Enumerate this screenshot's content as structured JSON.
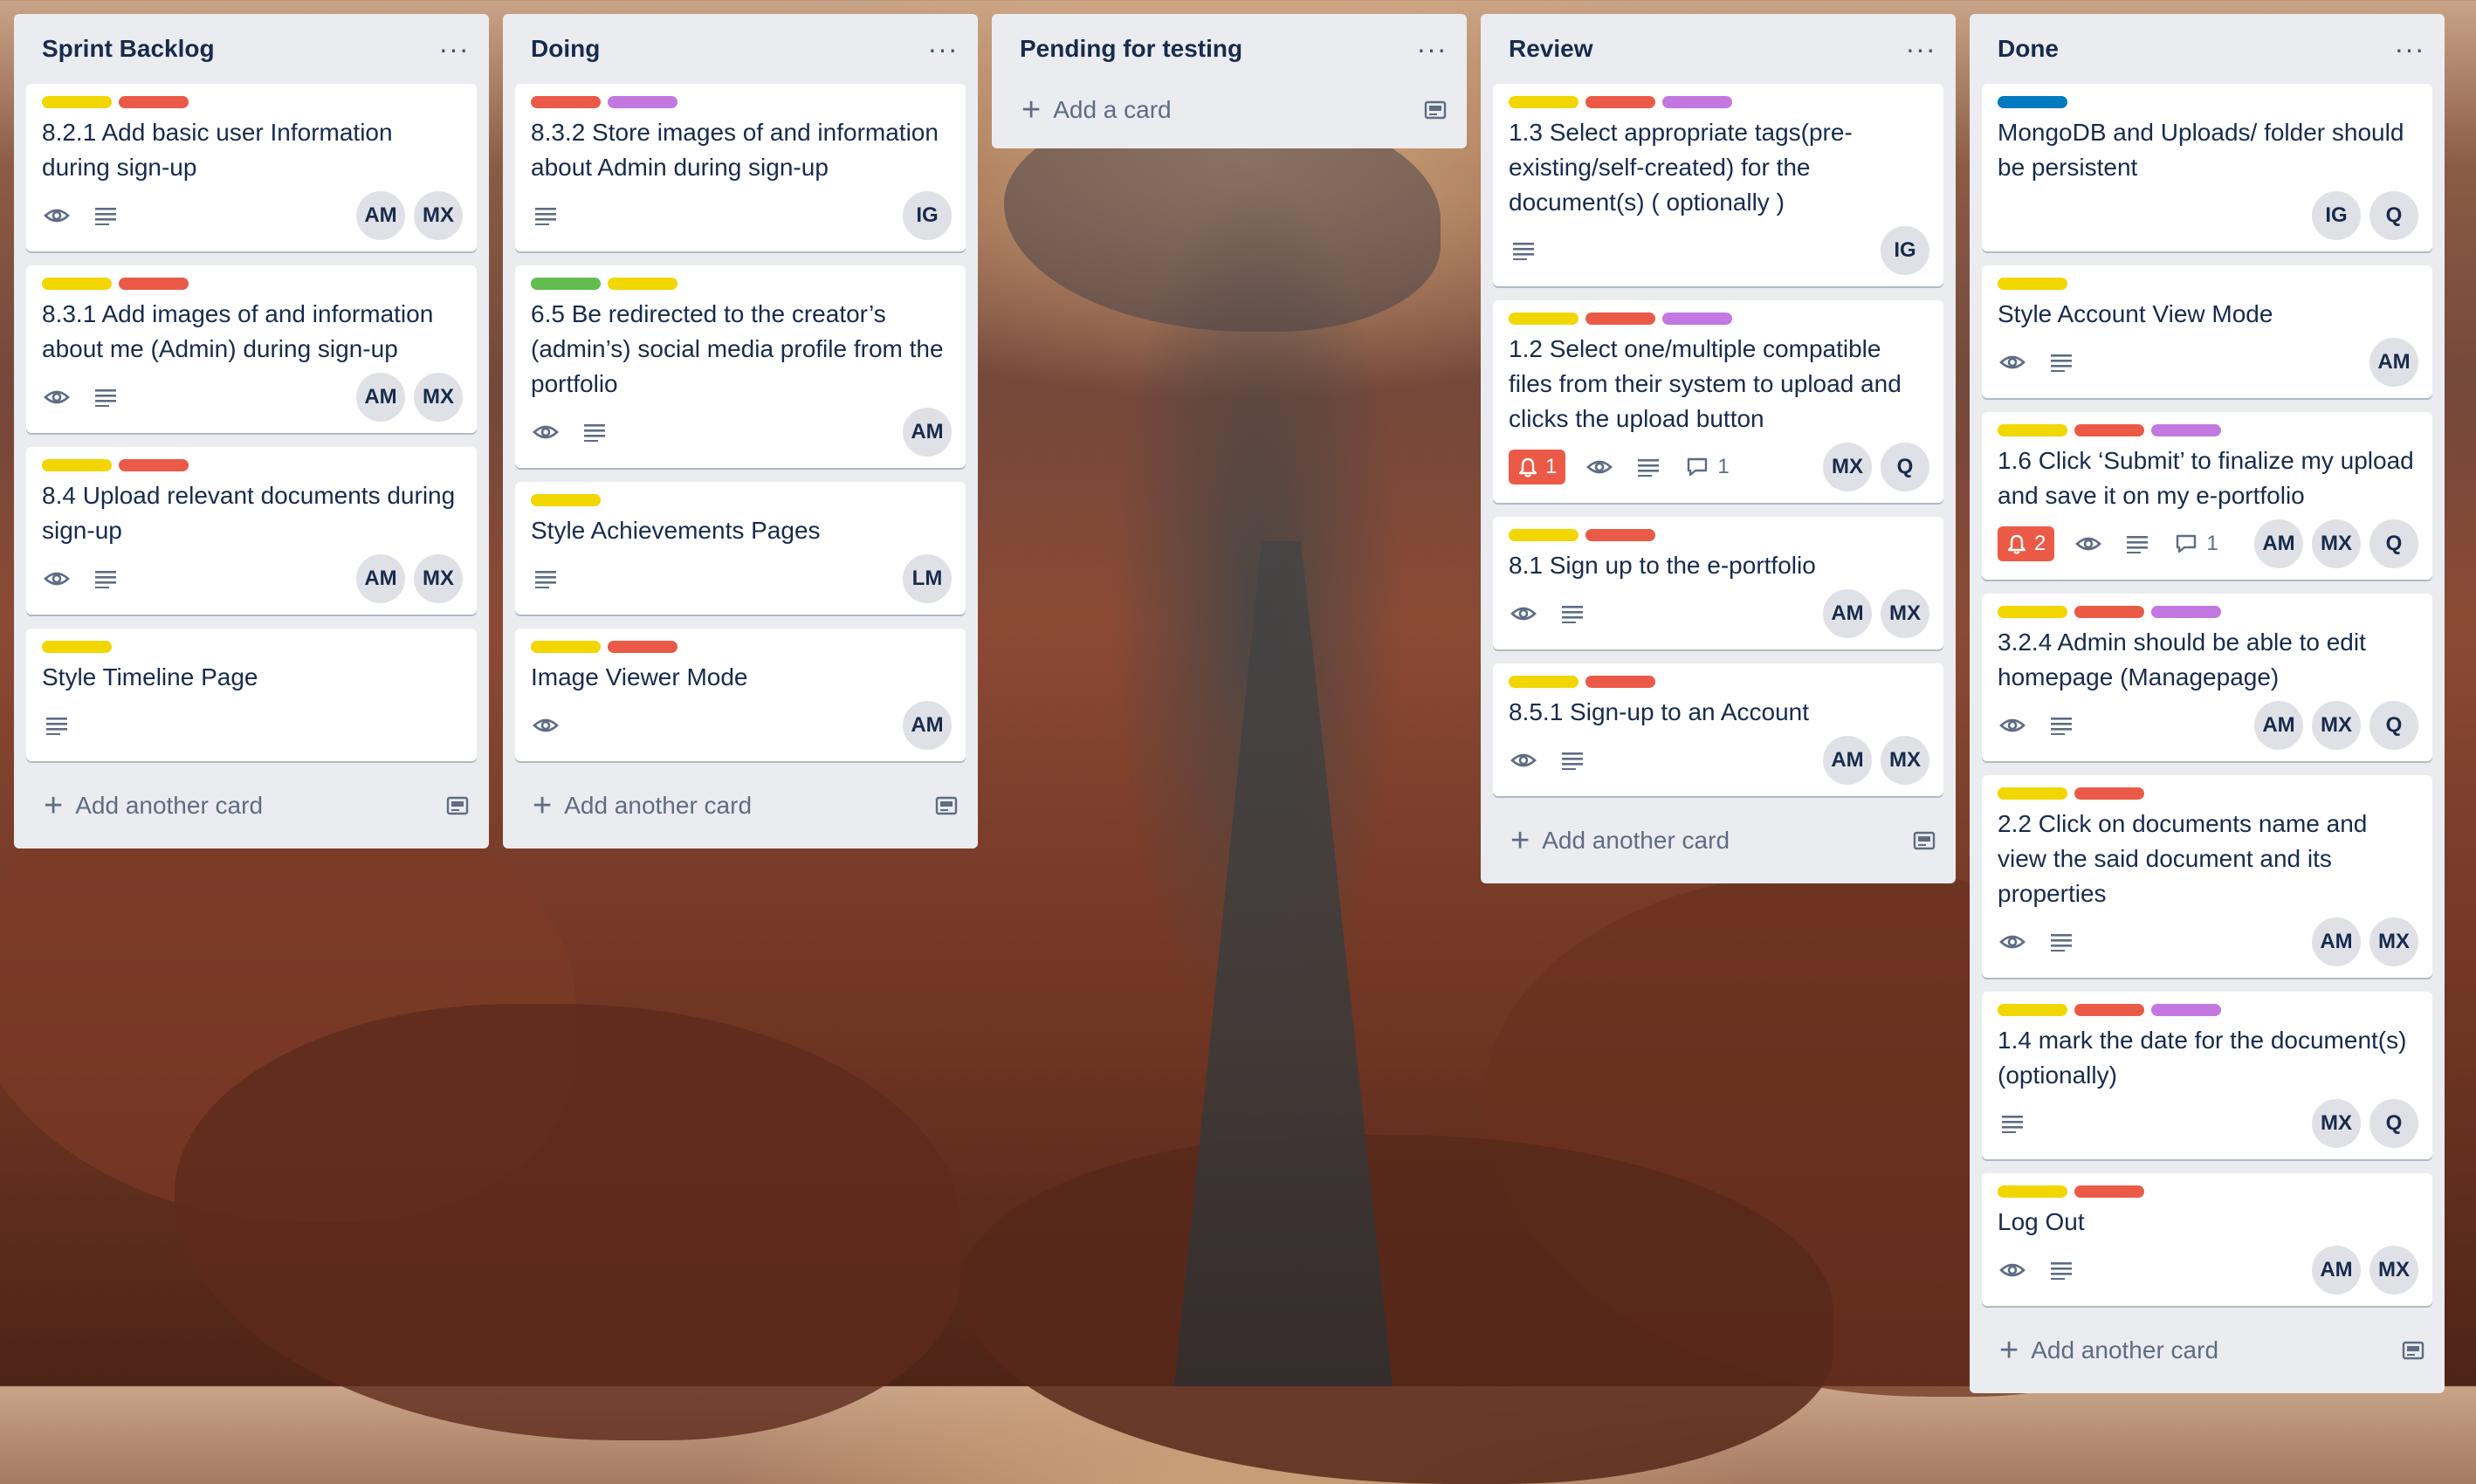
{
  "colors": {
    "yellow": "#f2d600",
    "red": "#eb5a46",
    "purple": "#c377e0",
    "green": "#61bd4f",
    "blue": "#0079bf"
  },
  "lists": [
    {
      "title": "Sprint Backlog",
      "add_label": "Add another card",
      "cards": [
        {
          "labels": [
            "yellow",
            "red"
          ],
          "title": "8.2.1 Add basic user Information during sign-up",
          "watch": true,
          "desc": true,
          "members": [
            "AM",
            "MX"
          ]
        },
        {
          "labels": [
            "yellow",
            "red"
          ],
          "title": "8.3.1 Add images of and information about me (Admin) during sign-up",
          "watch": true,
          "desc": true,
          "members": [
            "AM",
            "MX"
          ]
        },
        {
          "labels": [
            "yellow",
            "red"
          ],
          "title": "8.4 Upload relevant documents during sign-up",
          "watch": true,
          "desc": true,
          "members": [
            "AM",
            "MX"
          ]
        },
        {
          "labels": [
            "yellow"
          ],
          "title": "Style Timeline Page",
          "watch": false,
          "desc": true,
          "members": []
        }
      ]
    },
    {
      "title": "Doing",
      "add_label": "Add another card",
      "cards": [
        {
          "labels": [
            "red",
            "purple"
          ],
          "title": "8.3.2 Store images of and information about Admin during sign-up",
          "watch": false,
          "desc": true,
          "members": [
            "IG"
          ]
        },
        {
          "labels": [
            "green",
            "yellow"
          ],
          "title": "6.5 Be redirected to the creator’s (admin’s) social media profile from the portfolio",
          "watch": true,
          "desc": true,
          "members": [
            "AM"
          ]
        },
        {
          "labels": [
            "yellow"
          ],
          "title": "Style Achievements Pages",
          "watch": false,
          "desc": true,
          "members": [
            "LM"
          ]
        },
        {
          "labels": [
            "yellow",
            "red"
          ],
          "title": "Image Viewer Mode",
          "watch": true,
          "desc": false,
          "members": [
            "AM"
          ]
        }
      ]
    },
    {
      "title": "Pending for testing",
      "add_label": "Add a card",
      "cards": []
    },
    {
      "title": "Review",
      "add_label": "Add another card",
      "cards": [
        {
          "labels": [
            "yellow",
            "red",
            "purple"
          ],
          "title": "1.3 Select appropriate tags(pre-existing/self-created) for the document(s) ( optionally )",
          "watch": false,
          "desc": true,
          "members": [
            "IG"
          ]
        },
        {
          "labels": [
            "yellow",
            "red",
            "purple"
          ],
          "title": "1.2 Select one/multiple compatible files from their system to upload and clicks the upload button",
          "alert": "1",
          "watch": true,
          "desc": true,
          "comments": "1",
          "members": [
            "MX",
            "Q"
          ]
        },
        {
          "labels": [
            "yellow",
            "red"
          ],
          "title": "8.1 Sign up to the e-portfolio",
          "watch": true,
          "desc": true,
          "members": [
            "AM",
            "MX"
          ]
        },
        {
          "labels": [
            "yellow",
            "red"
          ],
          "title": "8.5.1 Sign-up to an Account",
          "watch": true,
          "desc": true,
          "members": [
            "AM",
            "MX"
          ]
        }
      ]
    },
    {
      "title": "Done",
      "add_label": "Add another card",
      "cards": [
        {
          "labels": [
            "blue"
          ],
          "title": "MongoDB and Uploads/ folder should be persistent",
          "watch": false,
          "desc": false,
          "members": [
            "IG",
            "Q"
          ]
        },
        {
          "labels": [
            "yellow"
          ],
          "title": "Style Account View Mode",
          "watch": true,
          "desc": true,
          "members": [
            "AM"
          ]
        },
        {
          "labels": [
            "yellow",
            "red",
            "purple"
          ],
          "title": "1.6 Click ‘Submit’ to finalize my upload and save it on my e-portfolio",
          "alert": "2",
          "watch": true,
          "desc": true,
          "comments": "1",
          "members": [
            "AM",
            "MX",
            "Q"
          ]
        },
        {
          "labels": [
            "yellow",
            "red",
            "purple"
          ],
          "title": "3.2.4 Admin should be able to edit homepage (Managepage)",
          "watch": true,
          "desc": true,
          "members": [
            "AM",
            "MX",
            "Q"
          ]
        },
        {
          "labels": [
            "yellow",
            "red"
          ],
          "title": "2.2 Click on documents name and view the said document and its properties",
          "watch": true,
          "desc": true,
          "members": [
            "AM",
            "MX"
          ]
        },
        {
          "labels": [
            "yellow",
            "red",
            "purple"
          ],
          "title": "1.4 mark the date for the document(s) (optionally)",
          "watch": false,
          "desc": true,
          "members": [
            "MX",
            "Q"
          ]
        },
        {
          "labels": [
            "yellow",
            "red"
          ],
          "title": "Log Out",
          "watch": true,
          "desc": true,
          "members": [
            "AM",
            "MX"
          ]
        }
      ]
    }
  ]
}
